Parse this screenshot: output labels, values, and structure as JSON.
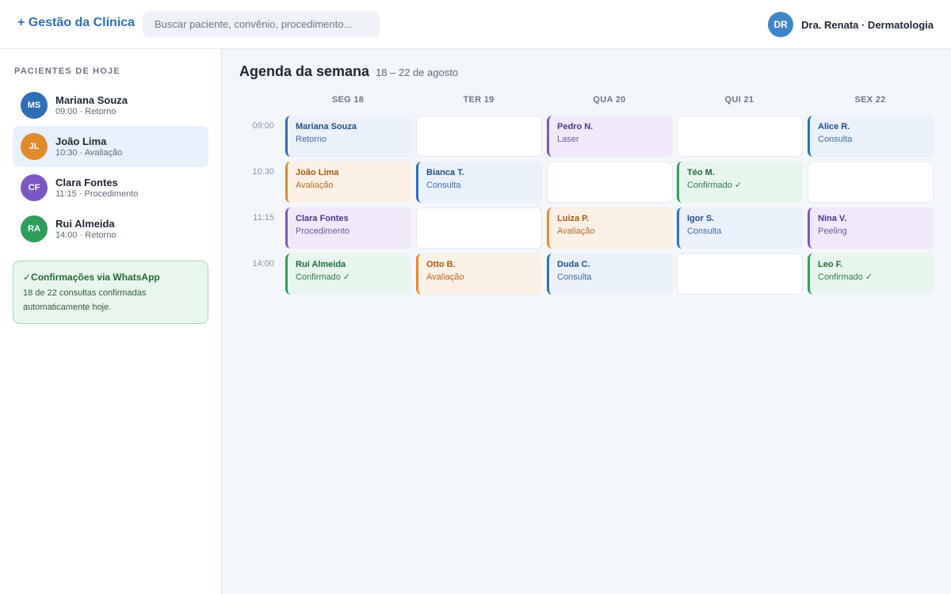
{
  "app": {
    "brand": "+ Gestão da Clínica"
  },
  "search": {
    "placeholder": "Buscar paciente, convênio, procedimento..."
  },
  "user": {
    "initials": "DR",
    "name": "Dra. Renata · Dermatologia",
    "avatar_color": "#3e86c9"
  },
  "sidebar": {
    "title": "PACIENTES DE HOJE",
    "patients": [
      {
        "initials": "MS",
        "name": "Mariana Souza",
        "detail": "09:00 · Retorno",
        "color": "#2d6fb5",
        "active": false
      },
      {
        "initials": "JL",
        "name": "João Lima",
        "detail": "10:30 · Avaliação",
        "color": "#e08a2c",
        "active": true
      },
      {
        "initials": "CF",
        "name": "Clara Fontes",
        "detail": "11:15 · Procedimento",
        "color": "#7b57c4",
        "active": false
      },
      {
        "initials": "RA",
        "name": "Rui Almeida",
        "detail": "14:00 · Retorno",
        "color": "#2f9e5b",
        "active": false
      }
    ],
    "notice": {
      "title": "✓Confirmações via WhatsApp",
      "body": "18 de 22 consultas confirmadas automaticamente hoje."
    }
  },
  "agenda": {
    "title": "Agenda da semana",
    "range": "18 – 22 de agosto",
    "days": [
      "SEG 18",
      "TER 19",
      "QUA 20",
      "QUI 21",
      "SEX 22"
    ],
    "times": [
      "09:00",
      "10:30",
      "11:15",
      "14:00"
    ],
    "rows": [
      [
        {
          "name": "Mariana Souza",
          "type": "Retorno",
          "color": "blue"
        },
        null,
        {
          "name": "Pedro N.",
          "type": "Laser",
          "color": "purple"
        },
        null,
        {
          "name": "Alice R.",
          "type": "Consulta",
          "color": "blue"
        }
      ],
      [
        {
          "name": "João Lima",
          "type": "Avaliação",
          "color": "orange"
        },
        {
          "name": "Bianca T.",
          "type": "Consulta",
          "color": "blue"
        },
        null,
        {
          "name": "Téo M.",
          "type": "Confirmado ✓",
          "color": "green"
        },
        null
      ],
      [
        {
          "name": "Clara Fontes",
          "type": "Procedimento",
          "color": "purple"
        },
        null,
        {
          "name": "Luiza P.",
          "type": "Avaliação",
          "color": "orange"
        },
        {
          "name": "Igor S.",
          "type": "Consulta",
          "color": "blue"
        },
        {
          "name": "Nina V.",
          "type": "Peeling",
          "color": "purple"
        }
      ],
      [
        {
          "name": "Rui Almeida",
          "type": "Confirmado ✓",
          "color": "green"
        },
        {
          "name": "Otto B.",
          "type": "Avaliação",
          "color": "orange"
        },
        {
          "name": "Duda C.",
          "type": "Consulta",
          "color": "blue"
        },
        null,
        {
          "name": "Leo F.",
          "type": "Confirmado ✓",
          "color": "green"
        }
      ]
    ]
  }
}
